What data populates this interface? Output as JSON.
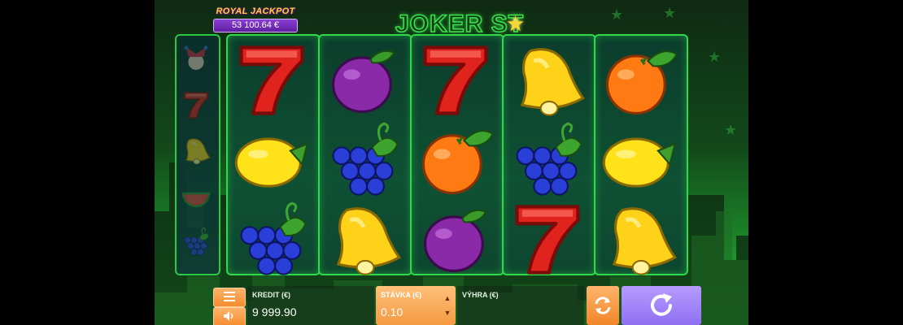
{
  "game": {
    "logo_text": "JOKER ST",
    "logo_star_glyph": "★",
    "jackpot_title": "ROYAL JACKPOT",
    "jackpot_value": "53 100.64 €"
  },
  "reels": [
    [
      "seven",
      "lemon",
      "grapes"
    ],
    [
      "plum",
      "grapes",
      "bell"
    ],
    [
      "seven",
      "orange",
      "plum"
    ],
    [
      "bell",
      "grapes",
      "seven"
    ],
    [
      "orange",
      "lemon",
      "bell"
    ]
  ],
  "mini_reel": [
    "joker",
    "seven",
    "bell",
    "watermelon",
    "grapes"
  ],
  "controls": {
    "menu_icon": "hamburger-menu-icon",
    "sound_icon": "speaker-icon",
    "credit_label": "KREDIT (€)",
    "credit_value": "9 999.90",
    "stake_label": "STÁVKA (€)",
    "stake_value": "0.10",
    "win_label": "VÝHRA (€)",
    "win_value": "",
    "autoplay_icon": "autoplay-arrows-icon",
    "spin_icon": "spin-arrow-icon"
  },
  "colors": {
    "frame_green": "#2fd94a",
    "orange_button": "#f48c2e",
    "spin_purple": "#8f70f3",
    "seven_red": "#e0231d"
  }
}
